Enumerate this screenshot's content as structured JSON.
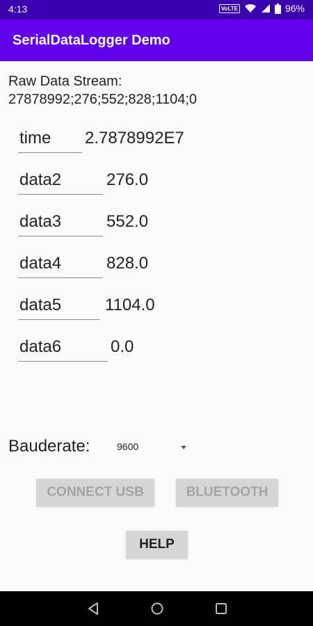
{
  "status_bar": {
    "time": "4:13",
    "volte_label": "VoLTE",
    "battery_percent": "96%",
    "icons": [
      "volte-icon",
      "wifi-icon",
      "signal-icon",
      "battery-icon"
    ]
  },
  "app_bar": {
    "title": "SerialDataLogger Demo",
    "color": "#6200ee"
  },
  "raw_stream": {
    "label": "Raw Data Stream:",
    "value": "27878992;276;552;828;1104;0"
  },
  "fields": [
    {
      "label": "time",
      "value": "2.7878992E7"
    },
    {
      "label": "data2",
      "value": "276.0"
    },
    {
      "label": "data3",
      "value": "552.0"
    },
    {
      "label": "data4",
      "value": "828.0"
    },
    {
      "label": "data5",
      "value": "1104.0"
    },
    {
      "label": "data6",
      "value": "0.0"
    }
  ],
  "baudrate": {
    "label": "Bauderate:",
    "selected": "9600"
  },
  "buttons": {
    "connect_usb": "CONNECT USB",
    "bluetooth": "BLUETOOTH",
    "help": "HELP"
  },
  "nav_bar": {
    "icons": [
      "back-icon",
      "home-icon",
      "recents-icon"
    ]
  }
}
